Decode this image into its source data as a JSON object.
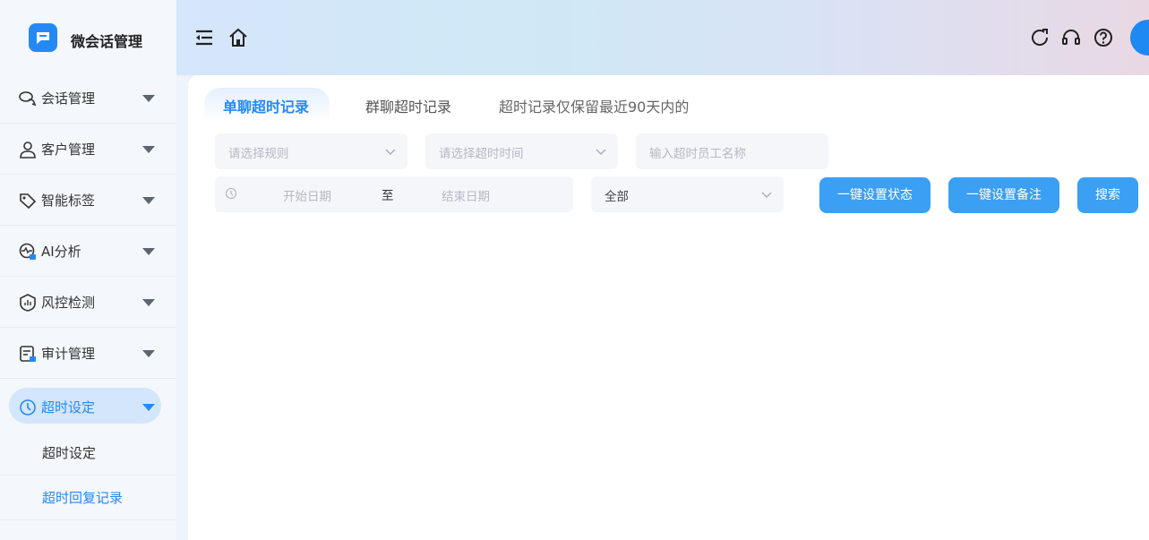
{
  "app": {
    "title": "微会话管理"
  },
  "sidebar": {
    "items": [
      {
        "label": "会话管理",
        "icon": "chat-bubbles-icon"
      },
      {
        "label": "客户管理",
        "icon": "user-icon"
      },
      {
        "label": "智能标签",
        "icon": "tag-icon"
      },
      {
        "label": "AI分析",
        "icon": "ai-analysis-icon"
      },
      {
        "label": "风控检测",
        "icon": "shield-icon"
      },
      {
        "label": "审计管理",
        "icon": "audit-icon"
      },
      {
        "label": "超时设定",
        "icon": "clock-icon"
      }
    ],
    "submenu": [
      {
        "label": "超时设定"
      },
      {
        "label": "超时回复记录"
      }
    ]
  },
  "topbar": {
    "icons": [
      "menu-collapse-icon",
      "home-icon",
      "refresh-icon",
      "headset-icon",
      "help-icon"
    ]
  },
  "tabs": {
    "single": "单聊超时记录",
    "group": "群聊超时记录",
    "note": "超时记录仅保留最近90天内的"
  },
  "filters": {
    "rule_placeholder": "请选择规则",
    "timeout_placeholder": "请选择超时时间",
    "employee_placeholder": "输入超时员工名称",
    "start_date_placeholder": "开始日期",
    "range_separator": "至",
    "end_date_placeholder": "结束日期",
    "status_value": "全部"
  },
  "actions": {
    "set_status": "一键设置状态",
    "set_remark": "一键设置备注",
    "search": "搜索"
  },
  "colors": {
    "accent": "#2589f5",
    "button": "#3b9ff3"
  }
}
